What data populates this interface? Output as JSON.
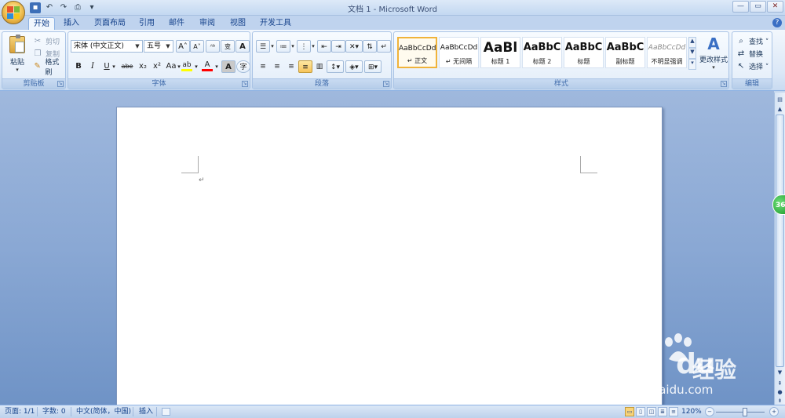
{
  "window": {
    "title": "文档 1 - Microsoft Word"
  },
  "tabs": [
    "开始",
    "插入",
    "页面布局",
    "引用",
    "邮件",
    "审阅",
    "视图",
    "开发工具"
  ],
  "clipboard": {
    "paste": "粘贴",
    "cut": "剪切",
    "copy": "复制",
    "format_painter": "格式刷",
    "label": "剪贴板"
  },
  "font": {
    "font_name": "宋体 (中文正文)",
    "font_size": "五号",
    "grow": "A˄",
    "shrink": "A˅",
    "bold": "B",
    "italic": "I",
    "underline": "U",
    "strikethrough": "abe",
    "subscript": "x₂",
    "superscript": "x²",
    "change_case": "Aa",
    "font_color_letter": "A",
    "label": "字体"
  },
  "paragraph": {
    "label": "段落"
  },
  "styles": {
    "label": "样式",
    "items": [
      {
        "sample": "AaBbCcDd",
        "name": "↵ 正文"
      },
      {
        "sample": "AaBbCcDd",
        "name": "↵ 无间隔"
      },
      {
        "sample": "AaBl",
        "name": "标题 1"
      },
      {
        "sample": "AaBbC",
        "name": "标题 2"
      },
      {
        "sample": "AaBbC",
        "name": "标题"
      },
      {
        "sample": "AaBbC",
        "name": "副标题"
      },
      {
        "sample": "AaBbCcDd",
        "name": "不明显强调"
      }
    ],
    "change_styles": "更改样式"
  },
  "editing": {
    "find": "查找 ˅",
    "replace": "替换",
    "select": "选择 ˅",
    "label": "编辑"
  },
  "status": {
    "page": "页面: 1/1",
    "words": "字数: 0",
    "language": "中文(简体，中国)",
    "mode": "插入",
    "zoom": "120%"
  },
  "document": {
    "paragraph_mark": "↵"
  },
  "watermark": {
    "brand": "Bai",
    "brand_tail": "du",
    "cn": "经验",
    "url": "jingyan.baidu.com"
  },
  "badge": "36",
  "colors": {
    "highlight": "#ffff00",
    "font_color": "#ff0000",
    "accent": "#15428b"
  }
}
